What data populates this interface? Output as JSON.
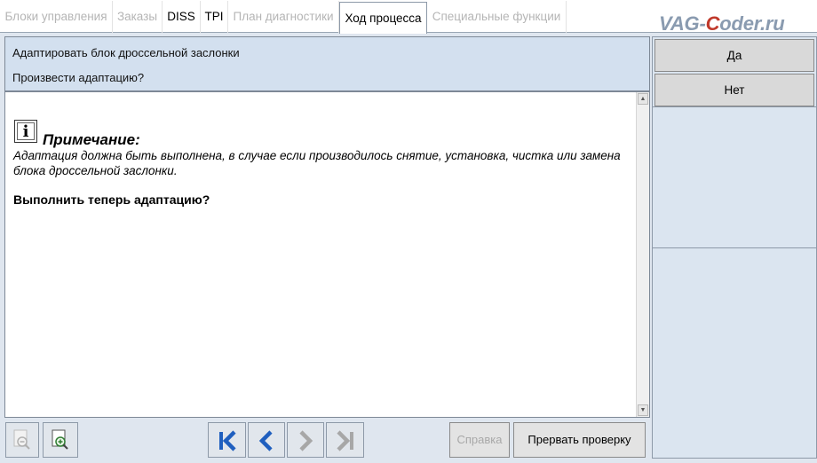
{
  "tabs": [
    {
      "label": "Блоки управления",
      "active": false
    },
    {
      "label": "Заказы",
      "active": false
    },
    {
      "label": "DISS",
      "active": false
    },
    {
      "label": "TPI",
      "active": false
    },
    {
      "label": "План диагностики",
      "active": false
    },
    {
      "label": "Ход процесса",
      "active": true
    },
    {
      "label": "Специальные функции",
      "active": false
    }
  ],
  "watermark": {
    "part1": "VAG-",
    "part2": "C",
    "part3": "oder.ru"
  },
  "header": {
    "title": "Адаптировать блок дроссельной заслонки",
    "question": "Произвести адаптацию?"
  },
  "content": {
    "note_title": "Примечание:",
    "note_body": "Адаптация должна быть выполнена, в случае если производилось  снятие, установка, чистка или замена блока дроссельной заслонки.",
    "question": "Выполнить теперь адаптацию?"
  },
  "side": {
    "yes_label": "Да",
    "no_label": "Нет"
  },
  "toolbar": {
    "help_label": "Справка",
    "abort_label": "Прервать проверку"
  },
  "colors": {
    "nav_blue": "#1f5fbf",
    "nav_gray": "#a7a7a7",
    "header_bg": "#d3e0ef"
  }
}
